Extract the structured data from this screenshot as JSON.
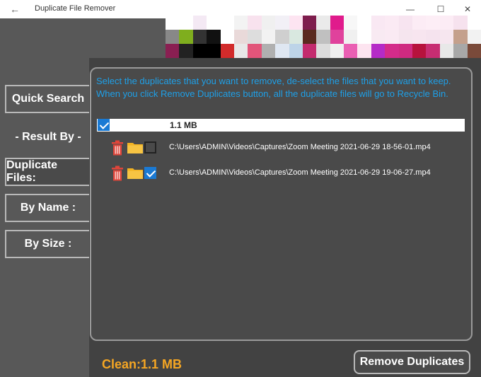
{
  "window": {
    "title": "Duplicate File Remover",
    "back_glyph": "←",
    "minimize_glyph": "—",
    "maximize_glyph": "☐",
    "close_glyph": "✕"
  },
  "sidebar": {
    "quick_search": "Quick Search",
    "result_by": "- Result By -",
    "duplicate_files": "Duplicate Files:",
    "by_name": "By Name :",
    "by_size": "By Size :"
  },
  "main": {
    "instructions": "Select the duplicates that you want to remove, de-select the files that you want to keep. When you click Remove Duplicates button, all the duplicate files will go to Recycle Bin.",
    "group": {
      "size": "1.1 MB",
      "checked": true
    },
    "files": [
      {
        "path": "C:\\Users\\ADMIN\\Videos\\Captures\\Zoom Meeting 2021-06-29 18-56-01.mp4",
        "checked": false
      },
      {
        "path": "C:\\Users\\ADMIN\\Videos\\Captures\\Zoom Meeting 2021-06-29 19-06-27.mp4",
        "checked": true
      }
    ]
  },
  "footer": {
    "clean_label": "Clean:1.1 MB",
    "remove_button": "Remove Duplicates"
  },
  "colors": {
    "accent_blue": "#1ea0e8",
    "clean_orange": "#f5a623",
    "trash_red": "#e0453a",
    "folder_yellow": "#f3b322"
  }
}
